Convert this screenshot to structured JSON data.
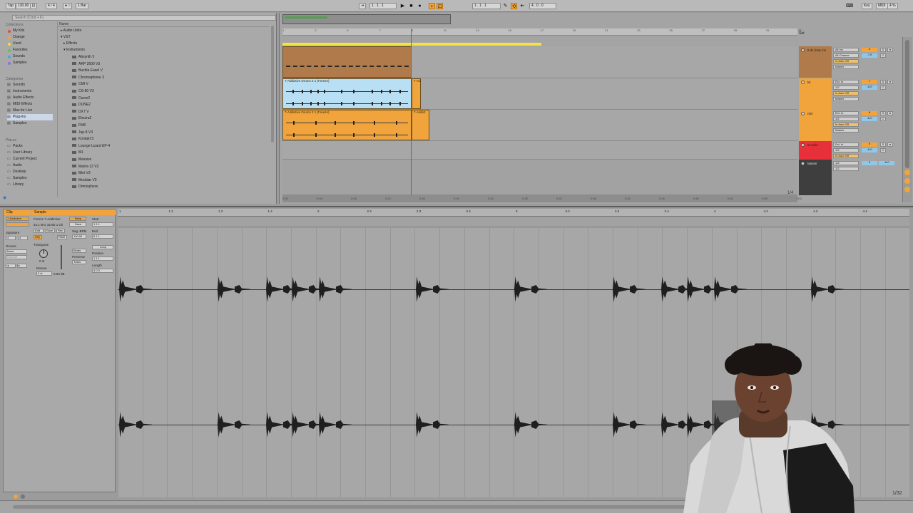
{
  "transport": {
    "tap": "Tap",
    "tempo": "130.00",
    "sig": "4 / 4",
    "bar": "1 Bar",
    "position": "1 .  1 .  1",
    "loop_start": "1 .  1 .  1",
    "loop_len": "4 .  0 .  0",
    "key": "Key",
    "midi": "MIDI",
    "cpu": "4 %"
  },
  "browser": {
    "search_placeholder": "Search (Cmd + F)",
    "collections_head": "Collections",
    "collections": [
      {
        "label": "My Kits",
        "color": "#e24b3b"
      },
      {
        "label": "Orange",
        "color": "#f0a43b"
      },
      {
        "label": "Used",
        "color": "#f2dc3a"
      },
      {
        "label": "Favorites",
        "color": "#5fc35a"
      },
      {
        "label": "Sounds",
        "color": "#4aa6e6"
      },
      {
        "label": "Samples",
        "color": "#9a6ce0"
      }
    ],
    "categories_head": "Categories",
    "categories": [
      "Sounds",
      "Instruments",
      "Audio Effects",
      "MIDI Effects",
      "Max for Live",
      "Plug-ins",
      "Samples"
    ],
    "categories_selected": "Plug-ins",
    "places_head": "Places",
    "places": [
      "Packs",
      "User Library",
      "Current Project",
      "Audio",
      "Desktop",
      "Samples",
      "Library"
    ],
    "name_header": "Name",
    "tree": {
      "audio_units": "Audio Units",
      "vst": "VST",
      "effects": "Effects",
      "instruments": "Instruments"
    },
    "plugins": [
      "Absynth 5",
      "ARP 2600 V3",
      "Buchla Easel V",
      "Chromaphone 3",
      "CMI V",
      "CS-80 V3",
      "Curve2",
      "DUNE2",
      "DX7 V",
      "Electra2",
      "FM8",
      "Jup-8 V3",
      "Kontakt 5",
      "Lounge Lizard EP-4",
      "M1",
      "Massive",
      "Matrix-12 V2",
      "Mini V3",
      "Modular V3",
      "Omnisphere"
    ]
  },
  "arrangement": {
    "ruler": [
      "1",
      "3",
      "5",
      "7",
      "9",
      "11",
      "13",
      "15",
      "17",
      "19",
      "21",
      "23",
      "25",
      "27",
      "29",
      "31",
      "33"
    ],
    "clip1_title": "7-Addictive Drums 2 1 (Freeze)",
    "clip1_tail": "7-Ad",
    "clip2_title": "7-Addictive Drums 2 1 (Freeze)",
    "clip2_tail": "7-Addict",
    "bottom_ruler": [
      "0:00",
      "0:04",
      "0:08",
      "0:12",
      "0:16",
      "0:20",
      "0:24",
      "0:28",
      "0:32",
      "0:36",
      "0:40",
      "0:44",
      "0:48",
      "0:52",
      "0:56",
      "1:00"
    ],
    "page": "1/4"
  },
  "mixer": {
    "set": "Set",
    "tracks": [
      {
        "name": "8 ds (Imp ms",
        "input": "All Ins",
        "channel": "All Channe",
        "monitor": "In  Auto  Off",
        "output": "Master",
        "vol": "0",
        "pan": "C",
        "val": "-7.6",
        "color": "#b07a4a"
      },
      {
        "name": "kit",
        "input": "Ext. In",
        "channel": "1/2",
        "monitor": "In  Auto  Off",
        "output": "Master",
        "vol": "7",
        "pan": "C",
        "val": "-6.0",
        "color": "#f0a43b"
      },
      {
        "name": "rdm",
        "input": "Ext. In",
        "channel": "1/2",
        "monitor": "In  Auto  Off",
        "output": "Master",
        "vol": "8",
        "pan": "C",
        "val": "-6.0",
        "color": "#f0a43b"
      },
      {
        "name": "9 Audio",
        "input": "Ext. In",
        "channel": "1/2",
        "monitor": "In  Auto  Off",
        "output": "Master",
        "vol": "9",
        "pan": "C",
        "val": "-6.0",
        "color": "#e8303a"
      }
    ],
    "master": {
      "name": "Master",
      "out1": "1/2",
      "out2": "1/2",
      "vol": "0",
      "val": "-6.0"
    }
  },
  "clip": {
    "clip_tab": "Clip",
    "sample_tab": "Sample",
    "clip_name": "7-Addictive",
    "sample_name": "Freeze 7-Addictive",
    "sample_info": "44.1 kHz 32 Bit 1 Ch",
    "warp": "Warp",
    "edit": "Edit",
    "save": "Save",
    "rev": "Rev",
    "seg_bpm_label": "Seg. BPM",
    "seg_bpm": "130.00",
    "hiq": "HiQ",
    "ram": "RAM",
    "signature_label": "Signature",
    "sig_num": "4",
    "sig_den": "4",
    "groove_label": "Groove",
    "groove_value": "None",
    "commit": "Commit",
    "transpose_label": "Transpose",
    "transpose_value": "0 st",
    "detune_label": "Detune",
    "detune_value": "0 ct",
    "gain_value": "0.00 dB",
    "beats": "Beats",
    "preserve_label": "Preserve",
    "preserve_value": "Trans",
    "start_label": "Start",
    "end_label": "End",
    "loop": "Loop",
    "position_label": "Position",
    "length_label": "Length",
    "start_val": "1  1  1",
    "end_val": "5  1  1",
    "position_val": "1  1  1",
    "length_val": "4  0  0"
  },
  "sample_editor": {
    "ruler": [
      "1",
      "1.2",
      "1.3",
      "1.4",
      "2",
      "2.2",
      "2.3",
      "2.4",
      "3",
      "3.2",
      "3.3",
      "3.4",
      "4",
      "4.2",
      "4.3",
      "4.4"
    ],
    "page": "1/32"
  }
}
